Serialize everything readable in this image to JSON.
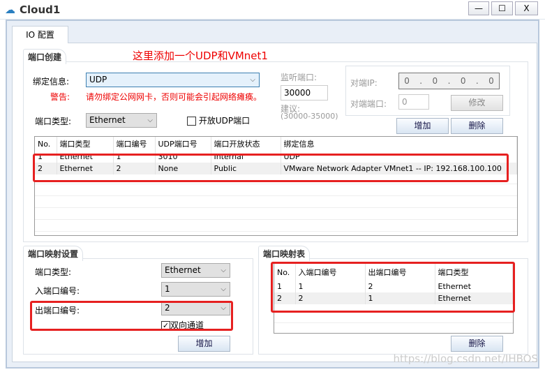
{
  "window": {
    "title": "Cloud1",
    "icon": "cloud-icon",
    "minimize": "—",
    "maximize": "☐",
    "close": "X"
  },
  "tab": "IO 配置",
  "annotation": "这里添加一个UDP和VMnet1",
  "create": {
    "group_label": "端口创建",
    "bind_label": "绑定信息:",
    "bind_value": "UDP",
    "warn_label": "警告:",
    "warn_text": "请勿绑定公网网卡，否则可能会引起网络瘫痪。",
    "type_label": "端口类型:",
    "type_value": "Ethernet",
    "open_udp_label": "开放UDP端口",
    "open_udp_checked": false,
    "listen_label": "监听端口:",
    "listen_value": "30000",
    "suggest_label": "建议:",
    "suggest_range": "(30000-35000)",
    "peer_ip_label": "对端IP:",
    "peer_ip": [
      "0",
      "0",
      "0",
      "0"
    ],
    "peer_port_label": "对端端口:",
    "peer_port": "0",
    "modify": "修改",
    "add": "增加",
    "delete": "删除",
    "table": {
      "headers": [
        "No.",
        "端口类型",
        "端口编号",
        "UDP端口号",
        "端口开放状态",
        "绑定信息"
      ],
      "rows": [
        [
          "1",
          "Ethernet",
          "1",
          "3010",
          "Internal",
          "UDP"
        ],
        [
          "2",
          "Ethernet",
          "2",
          "None",
          "Public",
          "VMware Network Adapter VMnet1 -- IP: 192.168.100.100"
        ]
      ]
    }
  },
  "mapping": {
    "group_label": "端口映射设置",
    "type_label": "端口类型:",
    "type_value": "Ethernet",
    "in_label": "入端口编号:",
    "in_value": "1",
    "out_label": "出端口编号:",
    "out_value": "2",
    "bidir_label": "双向通道",
    "bidir_checked": true,
    "add": "增加"
  },
  "map_table": {
    "group_label": "端口映射表",
    "headers": [
      "No.",
      "入端口编号",
      "出端口编号",
      "端口类型"
    ],
    "rows": [
      [
        "1",
        "1",
        "2",
        "Ethernet"
      ],
      [
        "2",
        "2",
        "1",
        "Ethernet"
      ]
    ],
    "delete": "删除"
  },
  "watermark": "https://blog.csdn.net/IHBOS"
}
